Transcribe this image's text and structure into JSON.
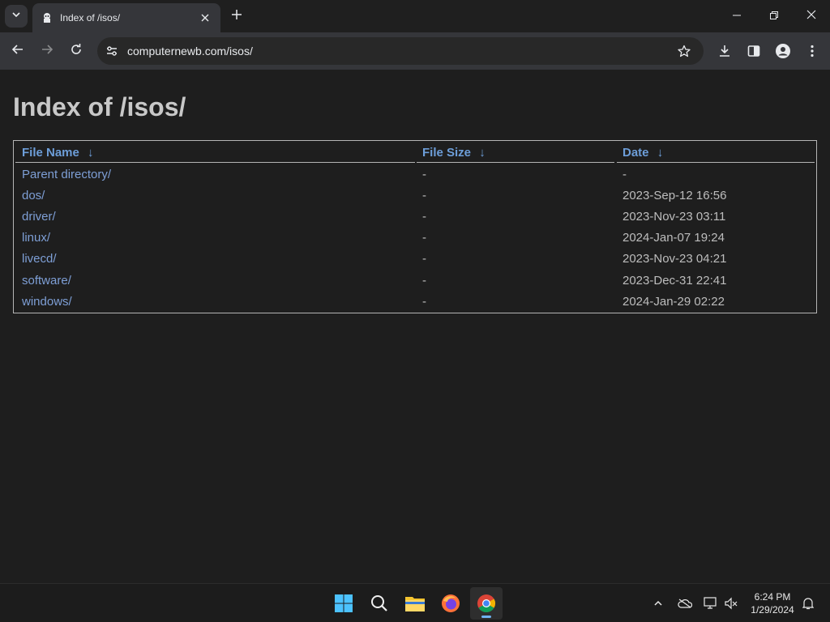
{
  "browser": {
    "tab_title": "Index of /isos/",
    "url": "computernewb.com/isos/",
    "icons": {
      "tab_search": "chevron-down-icon",
      "favicon": "site-favicon-icon",
      "tab_close": "close-icon",
      "new_tab": "plus-icon",
      "minimize": "minimize-icon",
      "restore": "restore-icon",
      "close_window": "close-icon",
      "back": "arrow-left-icon",
      "forward": "arrow-right-icon",
      "reload": "reload-icon",
      "site_info": "tune-icon",
      "bookmark": "star-icon",
      "downloads": "download-icon",
      "side_panel": "side-panel-icon",
      "profile": "profile-icon",
      "menu": "kebab-menu-icon"
    }
  },
  "page": {
    "title": "Index of /isos/",
    "columns": {
      "name": "File Name",
      "size": "File Size",
      "date": "Date",
      "sort_arrow": "↓"
    },
    "rows": [
      {
        "name": "Parent directory/",
        "size": "-",
        "date": "-"
      },
      {
        "name": "dos/",
        "size": "-",
        "date": "2023-Sep-12 16:56"
      },
      {
        "name": "driver/",
        "size": "-",
        "date": "2023-Nov-23 03:11"
      },
      {
        "name": "linux/",
        "size": "-",
        "date": "2024-Jan-07 19:24"
      },
      {
        "name": "livecd/",
        "size": "-",
        "date": "2023-Nov-23 04:21"
      },
      {
        "name": "software/",
        "size": "-",
        "date": "2023-Dec-31 22:41"
      },
      {
        "name": "windows/",
        "size": "-",
        "date": "2024-Jan-29 02:22"
      }
    ],
    "colors": {
      "link": "#7e9fd6",
      "header_link": "#6d9ed9",
      "background": "#1e1e1e",
      "title": "#c8c8c8"
    }
  },
  "taskbar": {
    "apps": [
      "windows-start-icon",
      "search-icon",
      "file-explorer-icon",
      "firefox-icon",
      "chrome-icon"
    ],
    "tray": [
      "chevron-up-icon",
      "onedrive-icon",
      "network-icon",
      "volume-muted-icon",
      "notification-bell-icon"
    ],
    "time": "6:24 PM",
    "date": "1/29/2024"
  }
}
